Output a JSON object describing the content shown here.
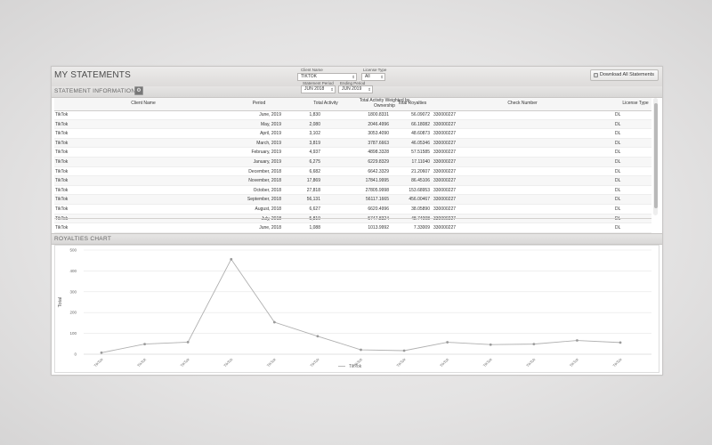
{
  "header": {
    "title": "MY STATEMENTS",
    "client_name_label": "Client Name",
    "client_name_value": "TIKTOK",
    "license_type_label": "License Type",
    "license_type_value": "All",
    "statement_period_label": "Statement Period",
    "statement_period_value": "JUN 2018",
    "ending_period_label": "Ending Period",
    "ending_period_value": "JUN 2019",
    "download_label": "Download All Statements"
  },
  "statement_section": {
    "title": "STATEMENT INFORMATION",
    "columns": [
      "Client Name",
      "Period",
      "Total Activity",
      "Total Activity Weighted by Ownership",
      "Total Royalties",
      "Check Number",
      "License Type"
    ],
    "rows": [
      [
        "TikTok",
        "June, 2019",
        "1,830",
        "1800.8331",
        "56.09072",
        "330000227",
        "DL"
      ],
      [
        "TikTok",
        "May, 2019",
        "2,080",
        "2046.4996",
        "66.18082",
        "330000227",
        "DL"
      ],
      [
        "TikTok",
        "April, 2019",
        "3,102",
        "3053.4090",
        "48.60873",
        "330000227",
        "DL"
      ],
      [
        "TikTok",
        "March, 2019",
        "3,819",
        "3787.6663",
        "46.05346",
        "330000227",
        "DL"
      ],
      [
        "TikTok",
        "February, 2019",
        "4,937",
        "4898.3328",
        "57.51585",
        "330000227",
        "DL"
      ],
      [
        "TikTok",
        "January, 2019",
        "6,275",
        "6229.8329",
        "17.11040",
        "330000227",
        "DL"
      ],
      [
        "TikTok",
        "December, 2018",
        "6,682",
        "6642.3329",
        "21.20607",
        "330000227",
        "DL"
      ],
      [
        "TikTok",
        "November, 2018",
        "17,869",
        "17841.9995",
        "86.45106",
        "330000227",
        "DL"
      ],
      [
        "TikTok",
        "October, 2018",
        "27,818",
        "27805.9998",
        "153.68953",
        "330000227",
        "DL"
      ],
      [
        "TikTok",
        "September, 2018",
        "56,131",
        "56117.1665",
        "456.00467",
        "330000227",
        "DL"
      ],
      [
        "TikTok",
        "August, 2018",
        "6,627",
        "6620.4996",
        "38.05890",
        "330000227",
        "DL"
      ],
      [
        "TikTok",
        "July, 2018",
        "5,819",
        "5747.8324",
        "48.74008",
        "330000227",
        "DL"
      ],
      [
        "TikTok",
        "June, 2018",
        "1,088",
        "1013.9992",
        "7.33009",
        "330000227",
        "DL"
      ]
    ]
  },
  "chart_section": {
    "title": "ROYALTIES CHART"
  },
  "chart_data": {
    "type": "line",
    "title": "",
    "xlabel": "",
    "ylabel": "Total",
    "ylim": [
      0,
      500
    ],
    "yticks": [
      0,
      100,
      200,
      300,
      400,
      500
    ],
    "categories": [
      "TikTok",
      "TikTok",
      "TikTok",
      "TikTok",
      "TikTok",
      "TikTok",
      "TikTok",
      "TikTok",
      "TikTok",
      "TikTok",
      "TikTok",
      "TikTok",
      "TikTok"
    ],
    "series": [
      {
        "name": "TikTok",
        "values": [
          7.33,
          48.74,
          58.06,
          456.0,
          153.69,
          86.45,
          21.21,
          17.11,
          57.52,
          46.05,
          48.61,
          66.18,
          56.09
        ]
      }
    ],
    "legend_position": "bottom",
    "grid": true,
    "line_color": "#b0b0b0"
  }
}
